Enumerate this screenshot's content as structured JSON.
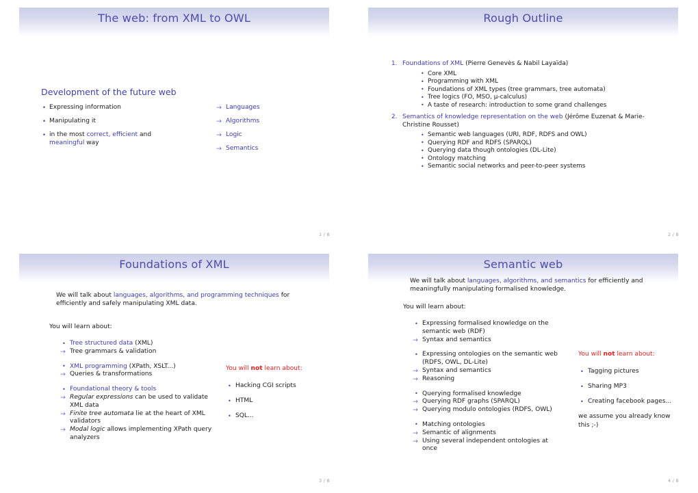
{
  "document": {
    "kind": "beamer-handout",
    "accent_blue": "#3b3bb0",
    "title_blue": "#4e4ea8",
    "alert_red": "#e02020",
    "banner_gradient_top": "#cccfe9",
    "banner_gradient_bottom": "#ffffff"
  },
  "slides": [
    {
      "title": "The web: from XML to OWL",
      "page": "1 / 8",
      "heading": "Development of the future web",
      "left_items": [
        {
          "pre": "Expressing information",
          "hl1": "",
          "mid": "",
          "hl2": "",
          "post": ""
        },
        {
          "pre": "Manipulating it",
          "hl1": "",
          "mid": "",
          "hl2": "",
          "post": ""
        },
        {
          "pre": "in the most ",
          "hl1": "correct, efficient",
          "mid": " and ",
          "hl2": "meaningful",
          "post": " way"
        }
      ],
      "right_items": [
        "Languages",
        "Algorithms",
        "Logic",
        "Semantics"
      ]
    },
    {
      "title": "Rough Outline",
      "page": "2 / 8",
      "sections": [
        {
          "link": "Foundations of XML",
          "authors": " (Pierre Genevès & Nabil Layaïda)",
          "bullets": [
            "Core XML",
            "Programming with XML",
            "Foundations of XML types (tree grammars, tree automata)",
            "Tree logics (FO, MSO, μ-calculus)",
            "A taste of research: introduction to some grand challenges"
          ]
        },
        {
          "link": "Semantics of knowledge representation on the web",
          "authors": " (Jérôme Euzenat & Marie-Christine Rousset)",
          "bullets": [
            "Semantic web languages (URI, RDF, RDFS and OWL)",
            "Querying RDF and RDFS (SPARQL)",
            "Querying data though ontologies (DL-Lite)",
            "Ontology matching",
            "Semantic social networks and peer-to-peer systems"
          ]
        }
      ]
    },
    {
      "title": "Foundations of XML",
      "page": "3 / 8",
      "intro_pre": "We will talk about ",
      "intro_hl": "languages, algorithms, and programming techniques",
      "intro_post": " for efficiently and safely manipulating XML data.",
      "learn_label": "You will learn about:",
      "left_items": [
        {
          "kind": "bullet",
          "gap": false,
          "hl": "Tree structured data",
          "rest": " (XML)",
          "ital": "",
          "ital_rest": ""
        },
        {
          "kind": "arrow",
          "gap": false,
          "hl": "",
          "rest": "Tree grammars & validation",
          "ital": "",
          "ital_rest": ""
        },
        {
          "kind": "bullet",
          "gap": true,
          "hl": "XML programming",
          "rest": " (XPath, XSLT...)",
          "ital": "",
          "ital_rest": ""
        },
        {
          "kind": "arrow",
          "gap": false,
          "hl": "",
          "rest": "Queries & transformations",
          "ital": "",
          "ital_rest": ""
        },
        {
          "kind": "bullet",
          "gap": true,
          "hl": "Foundational theory & tools",
          "rest": "",
          "ital": "",
          "ital_rest": ""
        },
        {
          "kind": "arrow",
          "gap": false,
          "hl": "",
          "rest": "",
          "ital": "Regular expressions",
          "ital_rest": " can be used to validate XML data"
        },
        {
          "kind": "arrow",
          "gap": false,
          "hl": "",
          "rest": "",
          "ital": "Finite tree automata",
          "ital_rest": " lie at the heart of XML validators"
        },
        {
          "kind": "arrow",
          "gap": false,
          "hl": "",
          "rest": "",
          "ital": "Modal logic",
          "ital_rest": " allows implementing XPath query analyzers"
        }
      ],
      "not_learn": {
        "pre": "You will ",
        "bold": "not",
        "post": " learn about:",
        "items": [
          "Hacking CGI scripts",
          "HTML",
          "SQL..."
        ],
        "tail": ""
      }
    },
    {
      "title": "Semantic web",
      "page": "4 / 8",
      "intro_pre": "We will talk about ",
      "intro_hl": "languages, algorithms, and semantics",
      "intro_post": " for efficiently and meaningfully manipulating formalised knowledge.",
      "learn_label": "You will learn about:",
      "left_items": [
        {
          "kind": "bullet",
          "gap": false,
          "hl": "",
          "rest": "Expressing formalised knowledge on the semantic web (RDF)",
          "ital": "",
          "ital_rest": ""
        },
        {
          "kind": "arrow",
          "gap": false,
          "hl": "",
          "rest": "Syntax and semantics",
          "ital": "",
          "ital_rest": ""
        },
        {
          "kind": "bullet",
          "gap": true,
          "hl": "",
          "rest": "Expressing ontologies on the semantic web (RDFS, OWL, DL-Lite)",
          "ital": "",
          "ital_rest": ""
        },
        {
          "kind": "arrow",
          "gap": false,
          "hl": "",
          "rest": "Syntax and semantics",
          "ital": "",
          "ital_rest": ""
        },
        {
          "kind": "arrow",
          "gap": false,
          "hl": "",
          "rest": "Reasoning",
          "ital": "",
          "ital_rest": ""
        },
        {
          "kind": "bullet",
          "gap": true,
          "hl": "",
          "rest": "Querying formalised knowledge",
          "ital": "",
          "ital_rest": ""
        },
        {
          "kind": "arrow",
          "gap": false,
          "hl": "",
          "rest": "Querying RDF graphs (SPARQL)",
          "ital": "",
          "ital_rest": ""
        },
        {
          "kind": "arrow",
          "gap": false,
          "hl": "",
          "rest": "Querying modulo ontologies (RDFS, OWL)",
          "ital": "",
          "ital_rest": ""
        },
        {
          "kind": "bullet",
          "gap": true,
          "hl": "",
          "rest": "Matching ontologies",
          "ital": "",
          "ital_rest": ""
        },
        {
          "kind": "arrow",
          "gap": false,
          "hl": "",
          "rest": "Semantic of alignments",
          "ital": "",
          "ital_rest": ""
        },
        {
          "kind": "arrow",
          "gap": false,
          "hl": "",
          "rest": "Using several independent ontologies at once",
          "ital": "",
          "ital_rest": ""
        }
      ],
      "not_learn": {
        "pre": "You will ",
        "bold": "not",
        "post": " learn about:",
        "items": [
          "Tagging pictures",
          "Sharing MP3",
          "Creating facebook pages..."
        ],
        "tail": "we assume you already know this ;-)"
      }
    }
  ]
}
